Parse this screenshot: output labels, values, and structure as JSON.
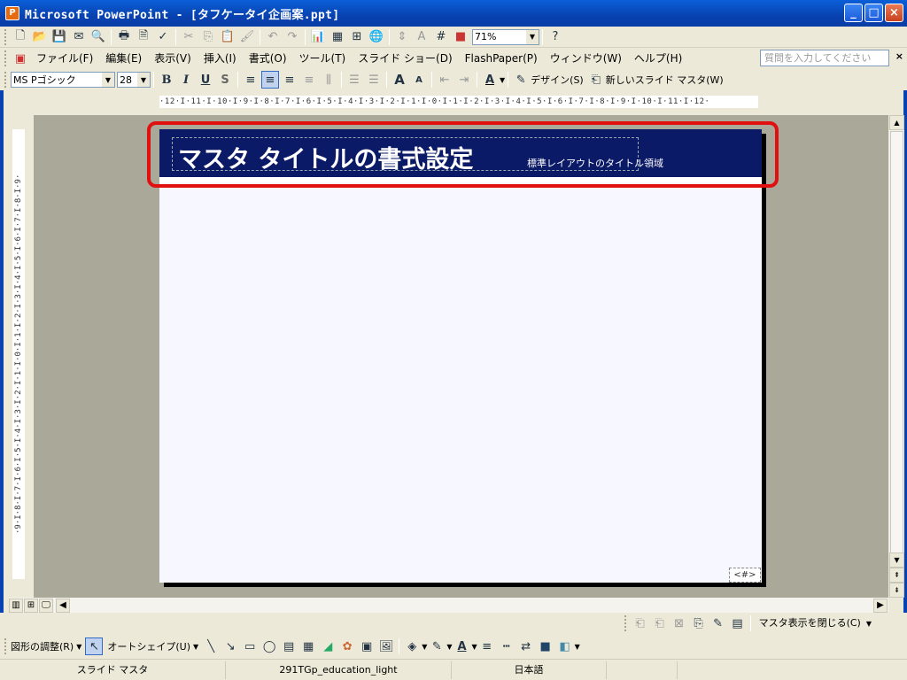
{
  "window": {
    "title": "Microsoft PowerPoint - [タフケータイ企画案.ppt]",
    "controls": {
      "minimize": "_",
      "maximize": "□",
      "close": "×"
    }
  },
  "standard_toolbar": {
    "zoom_value": "71%",
    "icons": [
      "new-icon",
      "open-icon",
      "save-icon",
      "permission-icon",
      "email-icon",
      "print-icon",
      "print-preview-icon",
      "spelling-icon",
      "cut-icon",
      "copy-icon",
      "paste-icon",
      "format-painter-icon",
      "undo-icon",
      "redo-icon",
      "insert-chart-icon",
      "insert-table-icon",
      "tables-borders-icon",
      "hyperlink-icon",
      "expand-icon",
      "show-formatting-icon",
      "grid-icon",
      "color-grayscale-icon",
      "help-icon"
    ]
  },
  "menu": {
    "items": [
      "ファイル(F)",
      "編集(E)",
      "表示(V)",
      "挿入(I)",
      "書式(O)",
      "ツール(T)",
      "スライド ショー(D)",
      "FlashPaper(P)",
      "ウィンドウ(W)",
      "ヘルプ(H)"
    ],
    "ask_placeholder": "質問を入力してください"
  },
  "formatting_toolbar": {
    "font": "MS Pゴシック",
    "size": "28",
    "bold": "B",
    "italic": "I",
    "underline": "U",
    "shadow": "S",
    "design_label": "デザイン(S)",
    "new_master_label": "新しいスライド マスタ(W)"
  },
  "ruler": {
    "horizontal": "·12·I·11·I·10·I·9·I·8·I·7·I·6·I·5·I·4·I·3·I·2·I·1·I·0·I·1·I·2·I·3·I·4·I·5·I·6·I·7·I·8·I·9·I·10·I·11·I·12·",
    "vertical": "·9·I·8·I·7·I·6·I·5·I·4·I·3·I·2·I·1·I·0·I·1·I·2·I·3·I·4·I·5·I·6·I·7·I·8·I·9·"
  },
  "slide": {
    "title_text": "マスタ タイトルの書式設定",
    "area_label": "標準レイアウトのタイトル領域",
    "number_placeholder": "<#>",
    "title_bg": "#0b1a66",
    "highlight_color": "#e01010"
  },
  "master_toolbar": {
    "close_label": "マスタ表示を閉じる(C)"
  },
  "drawing_toolbar": {
    "draw_label": "図形の調整(R)",
    "autoshape_label": "オートシェイプ(U)"
  },
  "status": {
    "view": "スライド マスタ",
    "template": "291TGp_education_light",
    "language": "日本語"
  }
}
